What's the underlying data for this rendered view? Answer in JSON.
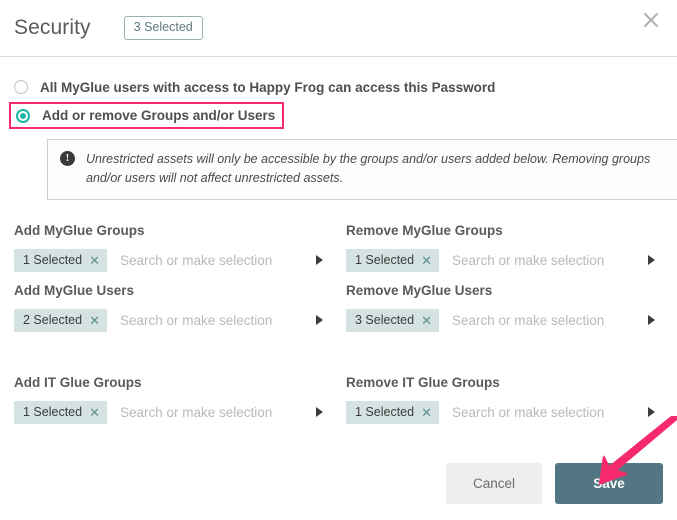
{
  "header": {
    "title": "Security",
    "badge": "3 Selected",
    "close_icon": "close-icon"
  },
  "options": {
    "radio_all": {
      "label": "All MyGlue users with access to Happy Frog can access this Password",
      "selected": false
    },
    "radio_add_remove": {
      "label": "Add or remove Groups and/or Users",
      "selected": true,
      "highlight_color": "#f5296b"
    }
  },
  "info": {
    "icon": "exclamation-circle-icon",
    "text": "Unrestricted assets will only be accessible by the groups and/or users added below. Removing groups and/or users will not affect unrestricted assets."
  },
  "fields": {
    "placeholder": "Search or make selection",
    "add_myglue_groups": {
      "label": "Add MyGlue Groups",
      "chip": "1 Selected"
    },
    "remove_myglue_groups": {
      "label": "Remove MyGlue Groups",
      "chip": "1 Selected"
    },
    "add_myglue_users": {
      "label": "Add MyGlue Users",
      "chip": "2 Selected"
    },
    "remove_myglue_users": {
      "label": "Remove MyGlue Users",
      "chip": "3 Selected"
    },
    "add_itglue_groups": {
      "label": "Add IT Glue Groups",
      "chip": "1 Selected"
    },
    "remove_itglue_groups": {
      "label": "Remove IT Glue Groups",
      "chip": "1 Selected"
    }
  },
  "footer": {
    "cancel_label": "Cancel",
    "save_label": "Save"
  },
  "colors": {
    "accent_teal": "#19b5a5",
    "save_button": "#527782",
    "annotation_pink": "#f5296b",
    "chip_background": "#d5e2e2"
  }
}
